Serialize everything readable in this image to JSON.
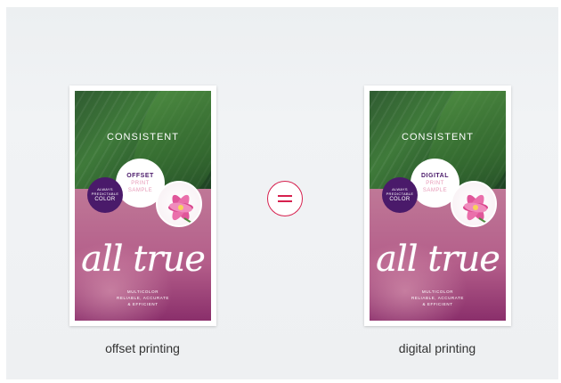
{
  "colors": {
    "accent": "#d6204e",
    "badge_purple": "#4a1a6a",
    "sample_pink": "#e79bb8"
  },
  "left": {
    "caption": "offset printing",
    "poster": {
      "headline": "CONSISTENT",
      "badge_line1": "ALWAYS",
      "badge_line2": "PREDICTABLE",
      "badge_line3": "COLOR",
      "print_type": "OFFSET",
      "print_line": "PRINT",
      "sample_line": "SAMPLE",
      "script_text": "all true",
      "footer1": "MULTICOLOR",
      "footer2": "RELIABLE, ACCURATE",
      "footer3": "& EFFICIENT"
    }
  },
  "right": {
    "caption": "digital printing",
    "poster": {
      "headline": "CONSISTENT",
      "badge_line1": "ALWAYS",
      "badge_line2": "PREDICTABLE",
      "badge_line3": "COLOR",
      "print_type": "DIGITAL",
      "print_line": "PRINT",
      "sample_line": "SAMPLE",
      "script_text": "all true",
      "footer1": "MULTICOLOR",
      "footer2": "RELIABLE, ACCURATE",
      "footer3": "& EFFICIENT"
    }
  },
  "equals_icon": "equals-icon"
}
